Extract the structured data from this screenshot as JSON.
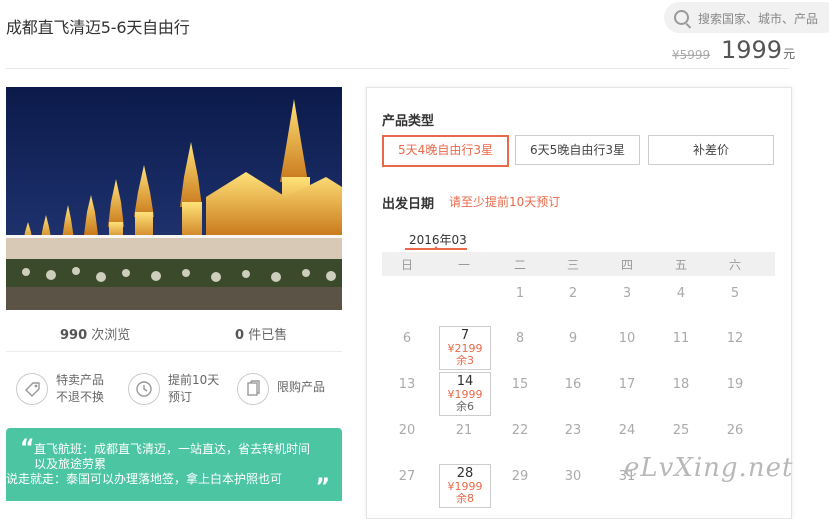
{
  "product": {
    "title": "成都直飞清迈5-6天自由行",
    "old_price": "¥5999",
    "price": "1999",
    "price_unit": "元"
  },
  "search": {
    "placeholder": "搜索国家、城市、产品"
  },
  "stats": {
    "views_num": "990",
    "views_label": "次浏览",
    "sold_num": "0",
    "sold_label": "件已售"
  },
  "features": [
    {
      "icon": "tag-icon",
      "line1": "特卖产品",
      "line2": "不退不换"
    },
    {
      "icon": "clock-icon",
      "line1": "提前10天",
      "line2": "预订"
    },
    {
      "icon": "copy-icon",
      "line1": "限购产品",
      "line2": ""
    }
  ],
  "promo": {
    "line1": "直飞航班：成都直飞清迈，一站直达，省去转机时间",
    "line2": "以及旅途劳累",
    "line3": "说走就走：泰国可以办理落地签，拿上白本护照也可"
  },
  "booking": {
    "type_title": "产品类型",
    "options": [
      "5天4晚自由行3星",
      "6天5晚自由行3星",
      "补差价"
    ],
    "selected_index": 0,
    "date_title": "出发日期",
    "date_hint": "请至少提前10天预订",
    "month": "2016年03",
    "weekdays": [
      "日",
      "一",
      "二",
      "三",
      "四",
      "五",
      "六"
    ],
    "rows": [
      [
        "",
        "",
        "1",
        "2",
        "3",
        "4",
        "5"
      ],
      [
        "6",
        "7",
        "8",
        "9",
        "10",
        "11",
        "12"
      ],
      [
        "13",
        "14",
        "15",
        "16",
        "17",
        "18",
        "19"
      ],
      [
        "20",
        "21",
        "22",
        "23",
        "24",
        "25",
        "26"
      ],
      [
        "27",
        "28",
        "29",
        "30",
        "31",
        "",
        ""
      ]
    ],
    "available": [
      {
        "day": "7",
        "price": "¥2199",
        "remain": "余3"
      },
      {
        "day": "14",
        "price": "¥1999",
        "remain": "余6"
      },
      {
        "day": "28",
        "price": "¥1999",
        "remain": "余8"
      }
    ]
  },
  "watermark": "eLvXing.net",
  "colors": {
    "accent": "#e86a4a",
    "promo_bg": "#4cc6a2"
  }
}
